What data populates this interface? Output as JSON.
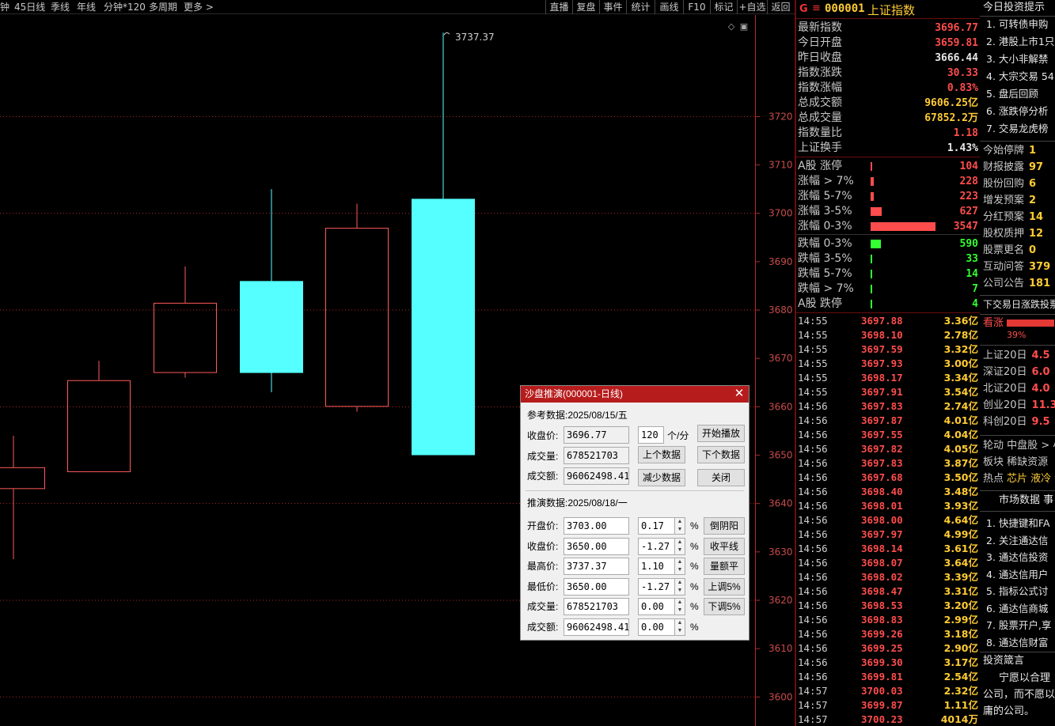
{
  "toolbar": {
    "left_items": [
      "钟",
      "45日线",
      "季线",
      "年线",
      "分钟*120",
      "多周期",
      "更多 >"
    ],
    "right_buttons": [
      "直播",
      "复盘",
      "事件",
      "统计",
      "画线",
      "F10",
      "标记",
      "+自选",
      "返回"
    ]
  },
  "chart_data": {
    "type": "candlestick",
    "y_ticks": [
      3600,
      3610,
      3620,
      3630,
      3640,
      3650,
      3660,
      3670,
      3680,
      3690,
      3700,
      3710,
      3720
    ],
    "ylim": [
      3594,
      3741
    ],
    "grid_dashed_levels": [
      3600,
      3620,
      3640,
      3660,
      3680,
      3700,
      3720
    ],
    "high_annotation": "3737.37",
    "candles": [
      {
        "open": 3643.0,
        "close": 3647.5,
        "high": 3654.0,
        "low": 3628.5,
        "up": true
      },
      {
        "open": 3646.5,
        "close": 3665.5,
        "high": 3669.5,
        "low": 3646.5,
        "up": true
      },
      {
        "open": 3667.0,
        "close": 3681.5,
        "high": 3689.0,
        "low": 3666.0,
        "up": true
      },
      {
        "open": 3686.0,
        "close": 3667.0,
        "high": 3705.0,
        "low": 3663.0,
        "up": false
      },
      {
        "open": 3660.0,
        "close": 3697.0,
        "high": 3702.0,
        "low": 3659.0,
        "up": true
      },
      {
        "open": 3703.0,
        "close": 3650.0,
        "high": 3737.37,
        "low": 3650.0,
        "up": false
      }
    ],
    "colors": {
      "up": "#ff5a5a",
      "down": "#55ffff",
      "grid": "#b42828",
      "axis": "#b42828",
      "tick_text": "#c84b4b"
    }
  },
  "quote": {
    "g_badge": "G",
    "menu_icon": "≡",
    "code": "000001",
    "name": "上证指数",
    "rows": [
      {
        "label": "最新指数",
        "value": "3696.77",
        "color": "#ff4d4d"
      },
      {
        "label": "今日开盘",
        "value": "3659.81",
        "color": "#ff4d4d"
      },
      {
        "label": "昨日收盘",
        "value": "3666.44",
        "color": "#e8e8e8"
      },
      {
        "label": "指数涨跌",
        "value": "30.33",
        "color": "#ff4d4d"
      },
      {
        "label": "指数涨幅",
        "value": "0.83%",
        "color": "#ff4d4d"
      },
      {
        "label": "总成交额",
        "value": "9606.25亿",
        "color": "#ffcc33"
      },
      {
        "label": "总成交量",
        "value": "67852.2万",
        "color": "#ffcc33"
      },
      {
        "label": "指数量比",
        "value": "1.18",
        "color": "#ff4d4d"
      },
      {
        "label": "上证换手",
        "value": "1.43%",
        "color": "#e8e8e8"
      }
    ]
  },
  "breadth": {
    "rows": [
      {
        "label": "A股 涨停",
        "value": "104",
        "color": "#ff4d4d",
        "fraction": 0.02
      },
      {
        "label": "涨幅 > 7%",
        "value": "228",
        "color": "#ff4d4d",
        "fraction": 0.05
      },
      {
        "label": "涨幅 5-7%",
        "value": "223",
        "color": "#ff4d4d",
        "fraction": 0.05
      },
      {
        "label": "涨幅 3-5%",
        "value": "627",
        "color": "#ff4d4d",
        "fraction": 0.17
      },
      {
        "label": "涨幅 0-3%",
        "value": "3547",
        "color": "#ff4d4d",
        "fraction": 1.0
      },
      {
        "label": "跌幅 0-3%",
        "value": "590",
        "color": "#33ff33",
        "fraction": 0.16
      },
      {
        "label": "跌幅 3-5%",
        "value": "33",
        "color": "#33ff33",
        "fraction": 0.01
      },
      {
        "label": "跌幅 5-7%",
        "value": "14",
        "color": "#33ff33",
        "fraction": 0.01
      },
      {
        "label": "跌幅 > 7%",
        "value": "7",
        "color": "#33ff33",
        "fraction": 0.01
      },
      {
        "label": "A股 跌停",
        "value": "4",
        "color": "#33ff33",
        "fraction": 0.01
      }
    ]
  },
  "ticks": [
    {
      "time": "14:55",
      "price": "3697.88",
      "amount": "3.36亿"
    },
    {
      "time": "14:55",
      "price": "3698.10",
      "amount": "2.78亿"
    },
    {
      "time": "14:55",
      "price": "3697.59",
      "amount": "3.32亿"
    },
    {
      "time": "14:55",
      "price": "3697.93",
      "amount": "3.00亿"
    },
    {
      "time": "14:55",
      "price": "3698.17",
      "amount": "3.34亿"
    },
    {
      "time": "14:55",
      "price": "3697.91",
      "amount": "3.54亿"
    },
    {
      "time": "14:56",
      "price": "3697.83",
      "amount": "2.74亿"
    },
    {
      "time": "14:56",
      "price": "3697.87",
      "amount": "4.01亿"
    },
    {
      "time": "14:56",
      "price": "3697.55",
      "amount": "4.04亿"
    },
    {
      "time": "14:56",
      "price": "3697.82",
      "amount": "4.05亿"
    },
    {
      "time": "14:56",
      "price": "3697.83",
      "amount": "3.87亿"
    },
    {
      "time": "14:56",
      "price": "3697.68",
      "amount": "3.50亿"
    },
    {
      "time": "14:56",
      "price": "3698.40",
      "amount": "3.48亿"
    },
    {
      "time": "14:56",
      "price": "3698.01",
      "amount": "3.93亿"
    },
    {
      "time": "14:56",
      "price": "3698.00",
      "amount": "4.64亿"
    },
    {
      "time": "14:56",
      "price": "3697.97",
      "amount": "4.99亿"
    },
    {
      "time": "14:56",
      "price": "3698.14",
      "amount": "3.61亿"
    },
    {
      "time": "14:56",
      "price": "3698.07",
      "amount": "3.64亿"
    },
    {
      "time": "14:56",
      "price": "3698.02",
      "amount": "3.39亿"
    },
    {
      "time": "14:56",
      "price": "3698.47",
      "amount": "3.31亿"
    },
    {
      "time": "14:56",
      "price": "3698.53",
      "amount": "3.20亿"
    },
    {
      "time": "14:56",
      "price": "3698.83",
      "amount": "2.99亿"
    },
    {
      "time": "14:56",
      "price": "3699.26",
      "amount": "3.18亿"
    },
    {
      "time": "14:56",
      "price": "3699.25",
      "amount": "2.90亿"
    },
    {
      "time": "14:56",
      "price": "3699.30",
      "amount": "3.17亿"
    },
    {
      "time": "14:56",
      "price": "3699.81",
      "amount": "2.54亿"
    },
    {
      "time": "14:57",
      "price": "3700.03",
      "amount": "2.32亿"
    },
    {
      "time": "14:57",
      "price": "3699.87",
      "amount": "1.11亿"
    },
    {
      "time": "14:57",
      "price": "3700.23",
      "amount": "4014万"
    }
  ],
  "news": {
    "header": "今日投资提示",
    "items": [
      "1. 可转债申购",
      "2. 港股上市1只",
      "3. 大小非解禁",
      "4. 大宗交易 54",
      "5. 盘后回顾",
      "6. 涨跌停分析",
      "7. 交易龙虎榜"
    ],
    "stats": [
      {
        "label": "今始停牌",
        "value": "1"
      },
      {
        "label": "财报披露",
        "value": "97"
      },
      {
        "label": "股份回购",
        "value": "6"
      },
      {
        "label": "增发预案",
        "value": "2"
      },
      {
        "label": "分红预案",
        "value": "14"
      },
      {
        "label": "股权质押",
        "value": "12"
      },
      {
        "label": "股票更名",
        "value": "0"
      },
      {
        "label": "互动问答",
        "value": "379"
      },
      {
        "label": "公司公告",
        "value": "181"
      }
    ],
    "forecast_title": "下交易日涨跌投票",
    "bullish_label": "看涨",
    "bullish_pct": "39%",
    "bullish_fraction": 0.39,
    "twenty_day": [
      {
        "label": "上证20日",
        "value": "4.5"
      },
      {
        "label": "深证20日",
        "value": "6.0"
      },
      {
        "label": "北证20日",
        "value": "4.0"
      },
      {
        "label": "创业20日",
        "value": "11.3"
      },
      {
        "label": "科创20日",
        "value": "9.5"
      }
    ],
    "rotation": "轮动 中盘股 > 小",
    "sector": "板块 稀缺资源",
    "hot_label": "热点",
    "hot_items": "芯片 液冷",
    "market_header": "市场数据 事",
    "market_items": [
      "1. 快捷键和FA",
      "2. 关注通达信",
      "3. 通达信投资",
      "4. 通达信用户",
      "5. 指标公式讨",
      "6. 通达信商城",
      "7. 股票开户,享",
      "8. 通达信财富"
    ],
    "quote_header": "投资箴言",
    "quote_lines": [
      "宁愿以合理",
      "公司，而不愿以",
      "庸的公司。"
    ]
  },
  "dialog": {
    "title": "沙盘推演(000001-日线)",
    "ref_label": "参考数据:2025/08/15/五",
    "close_label": "收盘价:",
    "close_value": "3696.77",
    "speed_value": "120",
    "speed_unit": "个/分",
    "play_button": "开始播放",
    "volume_label": "成交量:",
    "volume_value": "678521703",
    "prev_button": "上个数据",
    "next_button": "下个数据",
    "amount_label": "成交额:",
    "amount_value": "96062498.41",
    "reduce_button": "减少数据",
    "close_button": "关闭",
    "sim_label": "推演数据:2025/08/18/一",
    "sim_rows": [
      {
        "label": "开盘价:",
        "value": "3703.00",
        "pct": "0.17",
        "button": "倒阴阳"
      },
      {
        "label": "收盘价:",
        "value": "3650.00",
        "pct": "-1.27",
        "button": "收平线"
      },
      {
        "label": "最高价:",
        "value": "3737.37",
        "pct": "1.10",
        "button": "量额平"
      },
      {
        "label": "最低价:",
        "value": "3650.00",
        "pct": "-1.27",
        "button": "上调5%"
      },
      {
        "label": "成交量:",
        "value": "678521703",
        "pct": "0.00",
        "button": "下调5%"
      },
      {
        "label": "成交额:",
        "value": "96062498.41",
        "pct": "0.00",
        "button": ""
      }
    ],
    "pct_sign": "%"
  }
}
